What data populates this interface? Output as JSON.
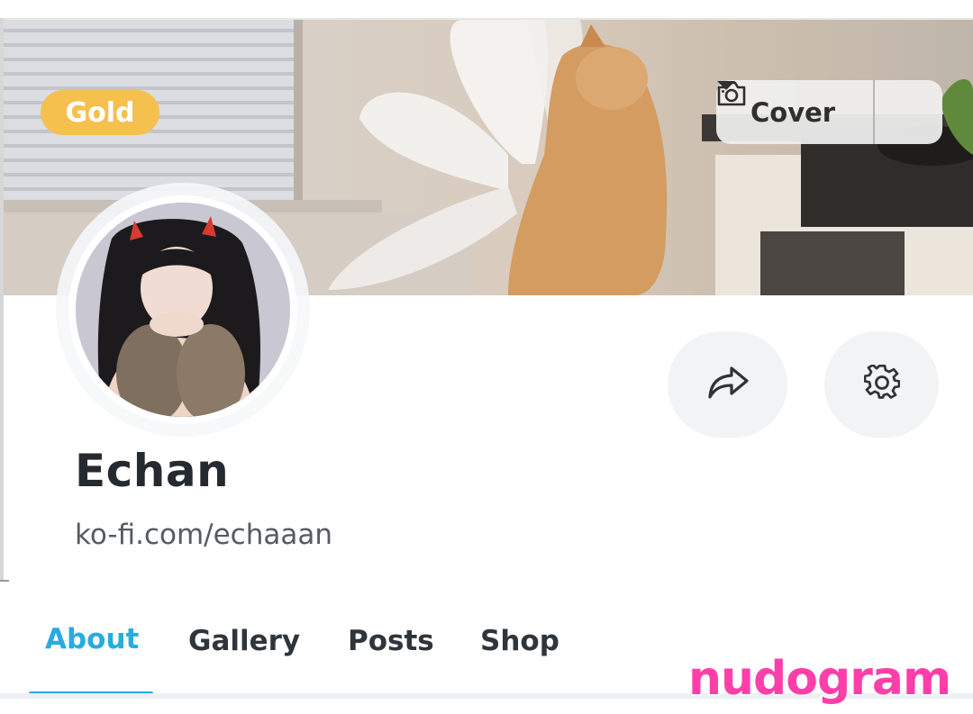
{
  "badge": {
    "label": "Gold",
    "color": "#f6c04e"
  },
  "cover_control": {
    "label": "Cover",
    "icon": "camera-icon",
    "dropdown_icon": "caret-down-icon"
  },
  "actions": {
    "share_icon": "share-icon",
    "settings_icon": "gear-icon"
  },
  "profile": {
    "name": "Echan",
    "url": "ko-fi.com/echaaan"
  },
  "tabs": [
    {
      "label": "About",
      "active": true
    },
    {
      "label": "Gallery",
      "active": false
    },
    {
      "label": "Posts",
      "active": false
    },
    {
      "label": "Shop",
      "active": false
    }
  ],
  "watermark": {
    "text": "nudogram",
    "color": "#ff3fa9"
  },
  "accent_color": "#29abe0"
}
